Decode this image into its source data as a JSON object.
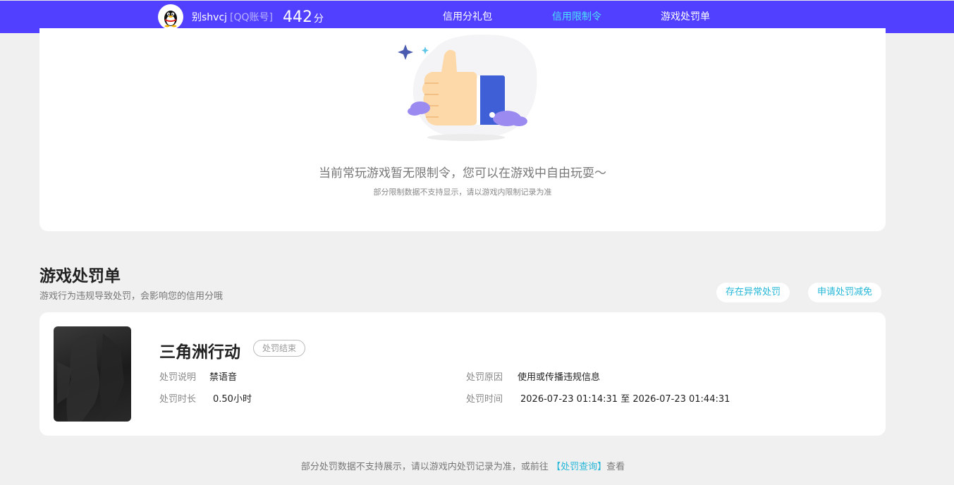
{
  "header": {
    "username": "别shvcj",
    "account_type": "[QQ账号]",
    "score": "442",
    "score_unit": "分",
    "nav": [
      {
        "label": "信用分礼包",
        "active": false
      },
      {
        "label": "信用限制令",
        "active": true
      },
      {
        "label": "游戏处罚单",
        "active": false
      }
    ],
    "accent_color": "#5140ff",
    "active_color": "#4ce3ff"
  },
  "restriction_card": {
    "illustration_icon": "thumbs-up-illustration",
    "title": "当前常玩游戏暂无限制令，您可以在游戏中自由玩耍～",
    "subtitle": "部分限制数据不支持显示，请以游戏内限制记录为准"
  },
  "penalty_section": {
    "title": "游戏处罚单",
    "subtitle": "游戏行为违规导致处罚，会影响您的信用分哦",
    "buttons": {
      "abnormal": "存在异常处罚",
      "appeal": "申请处罚减免"
    }
  },
  "penalty": {
    "game_name": "三角洲行动",
    "status": "处罚结束",
    "desc_label": "处罚说明",
    "desc_value": "禁语音",
    "reason_label": "处罚原因",
    "reason_value": "使用或传播违规信息",
    "duration_label": "处罚时长",
    "duration_value": "0.50小时",
    "time_label": "处罚时间",
    "time_value": "2026-07-23 01:14:31 至 2026-07-23 01:44:31"
  },
  "footer": {
    "prefix": "部分处罚数据不支持展示，请以游戏内处罚记录为准，或前往",
    "link": "【处罚查询】",
    "suffix": "查看"
  }
}
